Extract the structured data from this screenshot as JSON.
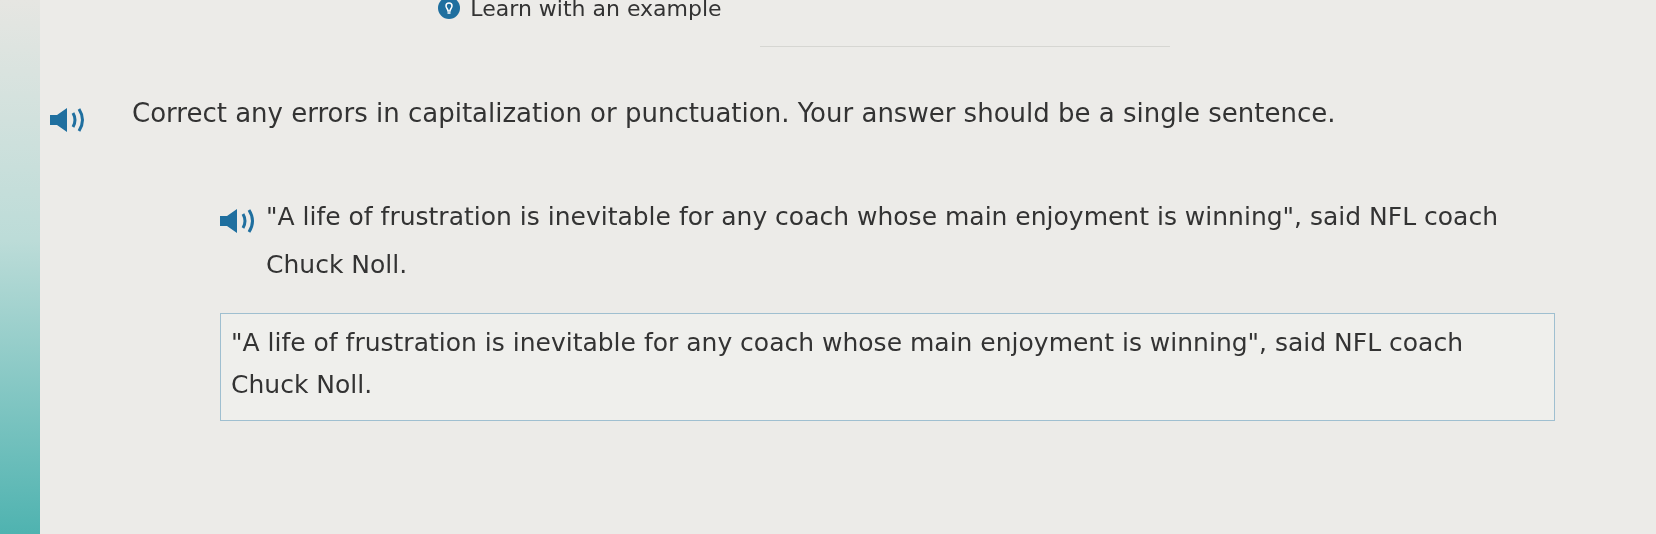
{
  "hint_link": {
    "label": "Learn with an example"
  },
  "instruction": "Correct any errors in capitalization or punctuation. Your answer should be a single sentence.",
  "prompt": "\"A life of frustration is inevitable for any coach whose main enjoyment is winning\", said NFL coach Chuck Noll.",
  "answer": {
    "value": "\"A life of frustration is inevitable for any coach whose main enjoyment is winning\", said NFL coach Chuck Noll."
  }
}
